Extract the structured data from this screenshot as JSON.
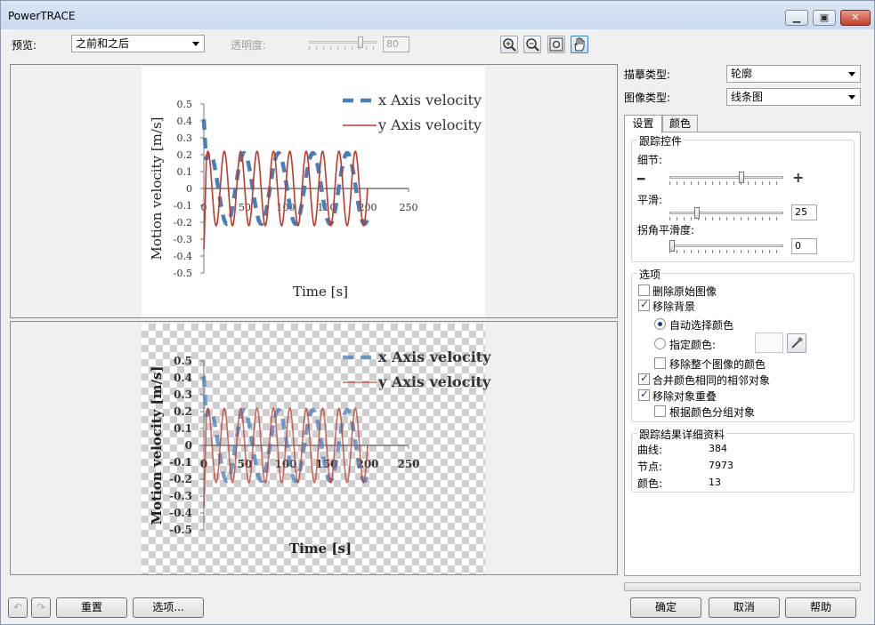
{
  "window": {
    "title": "PowerTRACE"
  },
  "toolbar": {
    "preview_label": "预览:",
    "preview_value": "之前和之后",
    "transparency_label": "透明度:",
    "transparency_value": "80"
  },
  "chart_data": {
    "type": "line",
    "xlabel": "Time [s]",
    "ylabel": "Motion velocity [m/s]",
    "xlim": [
      0,
      250
    ],
    "ylim": [
      -0.5,
      0.5
    ],
    "x_ticks": [
      "0",
      "50",
      "100",
      "150",
      "200",
      "250"
    ],
    "y_ticks": [
      "0.5",
      "0.4",
      "0.3",
      "0.2",
      "0.1",
      "0",
      "-0.1",
      "-0.2",
      "-0.3",
      "-0.4",
      "-0.5"
    ],
    "legend_position": "top-right",
    "series": [
      {
        "name": "x Axis velocity",
        "style": "dashed",
        "color": "#4a7ebb",
        "amplitude": 0.21,
        "period": 42,
        "phase": 0.5,
        "start_value": 0.41
      },
      {
        "name": "y Axis velocity",
        "style": "solid",
        "color": "#c0392b",
        "amplitude": 0.22,
        "period": 20,
        "phase": 0,
        "start_value": -0.36
      }
    ]
  },
  "right": {
    "trace_type_label": "描摹类型:",
    "trace_type_value": "轮廓",
    "image_type_label": "图像类型:",
    "image_type_value": "线条图",
    "tab_settings": "设置",
    "tab_colors": "颜色",
    "trace_controls_title": "跟踪控件",
    "detail_label": "细节:",
    "detail_level": 0.64,
    "smoothing_label": "平滑:",
    "smoothing_value": "25",
    "corner_label": "拐角平滑度:",
    "corner_value": "0",
    "options_title": "选项",
    "opt_delete_original": "删除原始图像",
    "opt_remove_bg": "移除背景",
    "opt_auto_color": "自动选择颜色",
    "opt_specify_color": "指定颜色:",
    "opt_remove_whole": "移除整个图像的颜色",
    "opt_merge_adjacent": "合并颜色相同的相邻对象",
    "opt_remove_overlap": "移除对象重叠",
    "opt_group_by_color": "根据颜色分组对象",
    "results_title": "跟踪结果详细资料",
    "curves_label": "曲线:",
    "curves_value": "384",
    "nodes_label": "节点:",
    "nodes_value": "7973",
    "colors_label": "颜色:",
    "colors_value": "13"
  },
  "buttons": {
    "reset": "重置",
    "options": "选项...",
    "ok": "确定",
    "cancel": "取消",
    "help": "帮助"
  }
}
